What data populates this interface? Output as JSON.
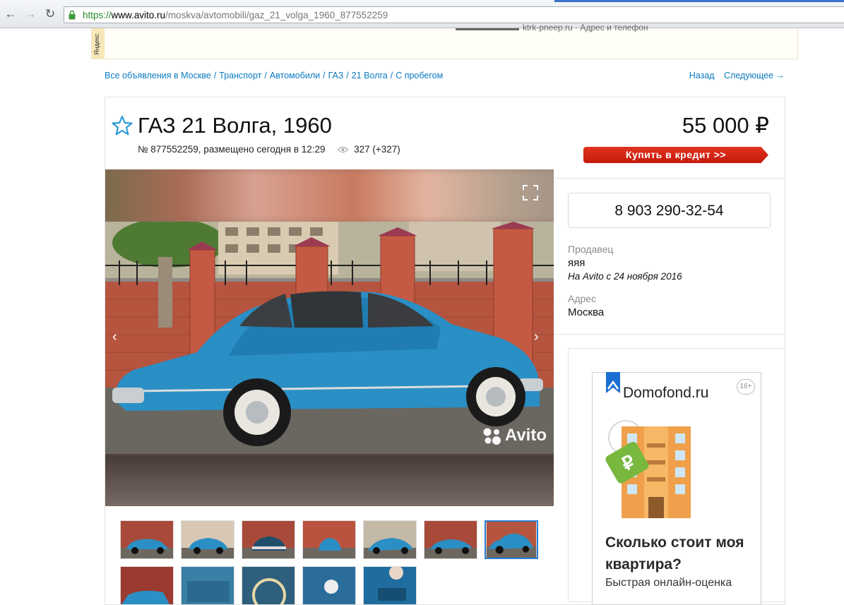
{
  "browser": {
    "url_protocol": "https://",
    "url_host": "www.avito.ru",
    "url_path": "/moskva/avtomobili/gaz_21_volga_1960_877552259"
  },
  "top_banner": {
    "side_label": "Яндекс",
    "text": "ktrk-pneep.ru · Адрес и телефон"
  },
  "breadcrumb": [
    "Все объявления в Москве",
    "Транспорт",
    "Автомобили",
    "ГАЗ",
    "21 Волга",
    "С пробегом"
  ],
  "pager": {
    "back": "Назад",
    "next": "Следующее →"
  },
  "listing": {
    "title": "ГАЗ 21 Волга, 1960",
    "meta": "№ 877552259, размещено сегодня в 12:29",
    "views": "327 (+327)",
    "price": "55 000 ₽",
    "credit_button": "Купить в кредит >>"
  },
  "gallery": {
    "watermark": "Avito",
    "thumbnail_count": 12,
    "active_thumbnail": 7
  },
  "seller": {
    "phone": "8 903 290-32-54",
    "seller_label": "Продавец",
    "seller_name": "яяя",
    "seller_since": "На Avito с 24 ноября 2016",
    "address_label": "Адрес",
    "address": "Москва"
  },
  "ad": {
    "logo": "Domofond.ru",
    "age": "16+",
    "headline": "Сколько стоит моя квартира?",
    "sub": "Быстрая онлайн-оценка"
  },
  "colors": {
    "link": "#0a7bc1",
    "credit_red": "#d2230f",
    "car_blue": "#2a8fc4"
  }
}
